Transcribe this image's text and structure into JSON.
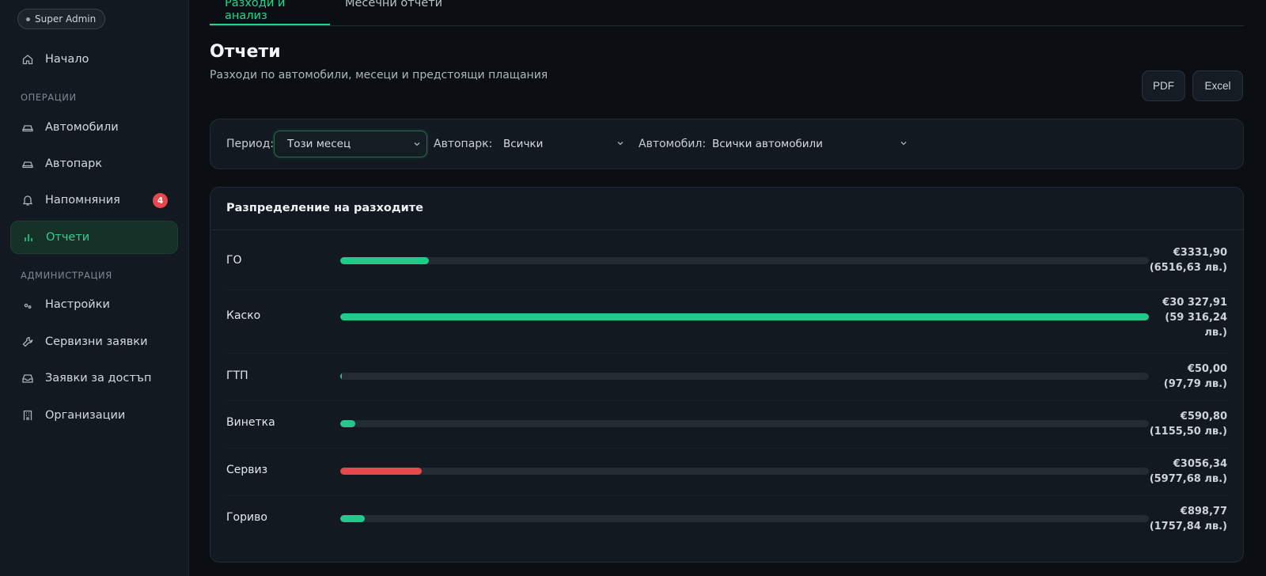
{
  "sidebar": {
    "role_badge": "Super Admin",
    "sections": {
      "operations": "ОПЕРАЦИИ",
      "administration": "АДМИНИСТРАЦИЯ"
    },
    "items": [
      {
        "label": "Начало",
        "icon": "home-icon"
      },
      {
        "label": "Автомобили",
        "icon": "car-icon"
      },
      {
        "label": "Автопарк",
        "icon": "fleet-icon"
      },
      {
        "label": "Напомняния",
        "icon": "bell-icon",
        "badge": "4"
      },
      {
        "label": "Отчети",
        "icon": "chart-icon",
        "active": true
      },
      {
        "label": "Настройки",
        "icon": "settings-icon"
      },
      {
        "label": "Сервизни заявки",
        "icon": "wrench-icon"
      },
      {
        "label": "Заявки за достъп",
        "icon": "inbox-icon"
      },
      {
        "label": "Организации",
        "icon": "building-icon"
      }
    ]
  },
  "tabs": [
    {
      "label": "Разходи и анализ",
      "active": true
    },
    {
      "label": "Месечни отчети",
      "active": false
    }
  ],
  "page": {
    "title": "Отчети",
    "subtitle": "Разходи по автомобили, месеци и предстоящи плащания"
  },
  "export": {
    "pdf_label": "PDF",
    "excel_label": "Excel"
  },
  "filters": {
    "period_label": "Период:",
    "period_value": "Този месец",
    "fleet_label": "Автопарк:",
    "fleet_value": "Всички",
    "vehicle_label": "Автомобил:",
    "vehicle_value": "Всички автомобили"
  },
  "distribution": {
    "title": "Разпределение на разходите",
    "rows": [
      {
        "label": "ГО",
        "eur": "€3331,90",
        "bgn": "(6516,63 лв.)",
        "fraction": 0.11,
        "color": "#22c98b"
      },
      {
        "label": "Каско",
        "eur": "€30 327,91",
        "bgn": "(59 316,24 лв.)",
        "fraction": 1.0,
        "color": "#22c98b"
      },
      {
        "label": "ГТП",
        "eur": "€50,00",
        "bgn": "(97,79 лв.)",
        "fraction": 0.002,
        "color": "#22c98b"
      },
      {
        "label": "Винетка",
        "eur": "€590,80",
        "bgn": "(1155,50 лв.)",
        "fraction": 0.019,
        "color": "#22c98b"
      },
      {
        "label": "Сервиз",
        "eur": "€3056,34",
        "bgn": "(5977,68 лв.)",
        "fraction": 0.101,
        "color": "#e5484d"
      },
      {
        "label": "Гориво",
        "eur": "€898,77",
        "bgn": "(1757,84 лв.)",
        "fraction": 0.03,
        "color": "#22c98b"
      }
    ]
  }
}
